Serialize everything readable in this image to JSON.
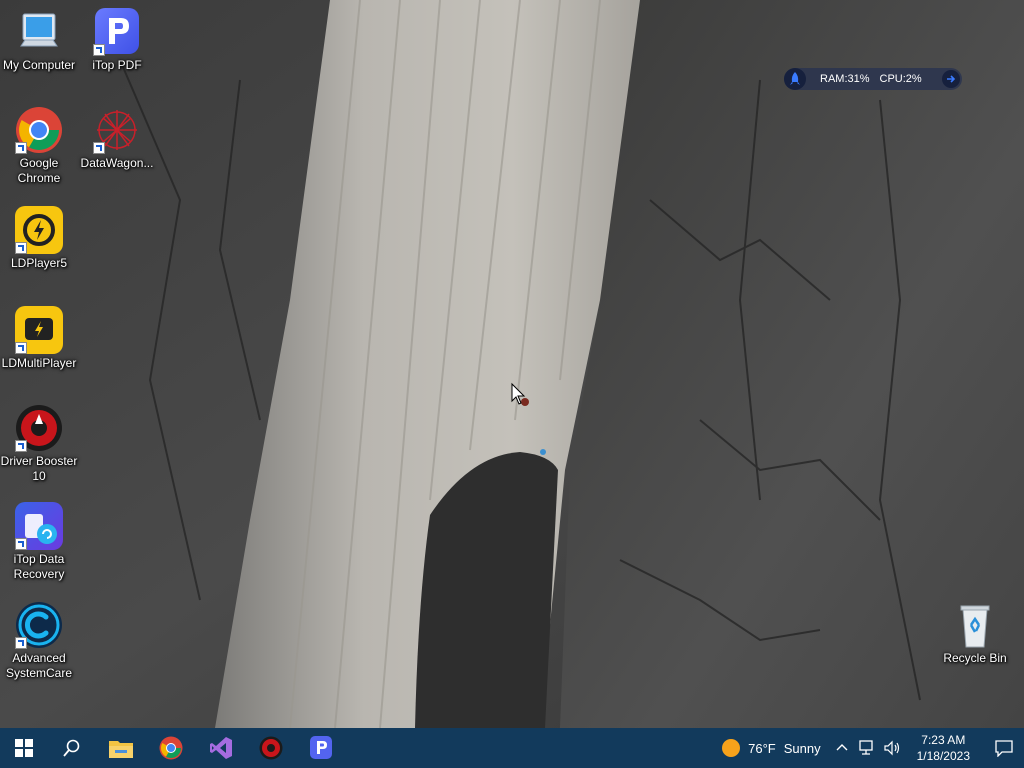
{
  "desktop": {
    "icons": [
      {
        "label": "My Computer"
      },
      {
        "label": "iTop PDF"
      },
      {
        "label": "Google Chrome"
      },
      {
        "label": "DataWagon..."
      },
      {
        "label": "LDPlayer5"
      },
      {
        "label": "LDMultiPlayer"
      },
      {
        "label": "Driver Booster 10"
      },
      {
        "label": "iTop Data Recovery"
      },
      {
        "label": "Advanced SystemCare"
      },
      {
        "label": "Recycle Bin"
      }
    ]
  },
  "sysmon": {
    "ram": "RAM:31%",
    "cpu": "CPU:2%"
  },
  "taskbar": {
    "apps": [
      "start-icon",
      "search-icon",
      "file-explorer-icon",
      "chrome-icon",
      "visual-studio-icon",
      "driver-booster-icon",
      "itop-pdf-icon"
    ],
    "weather": {
      "temp": "76°F",
      "condition": "Sunny"
    },
    "clock": {
      "time": "7:23 AM",
      "date": "1/18/2023"
    }
  },
  "colors": {
    "taskbar": "#123a5c",
    "accent": "#1a73e8"
  }
}
